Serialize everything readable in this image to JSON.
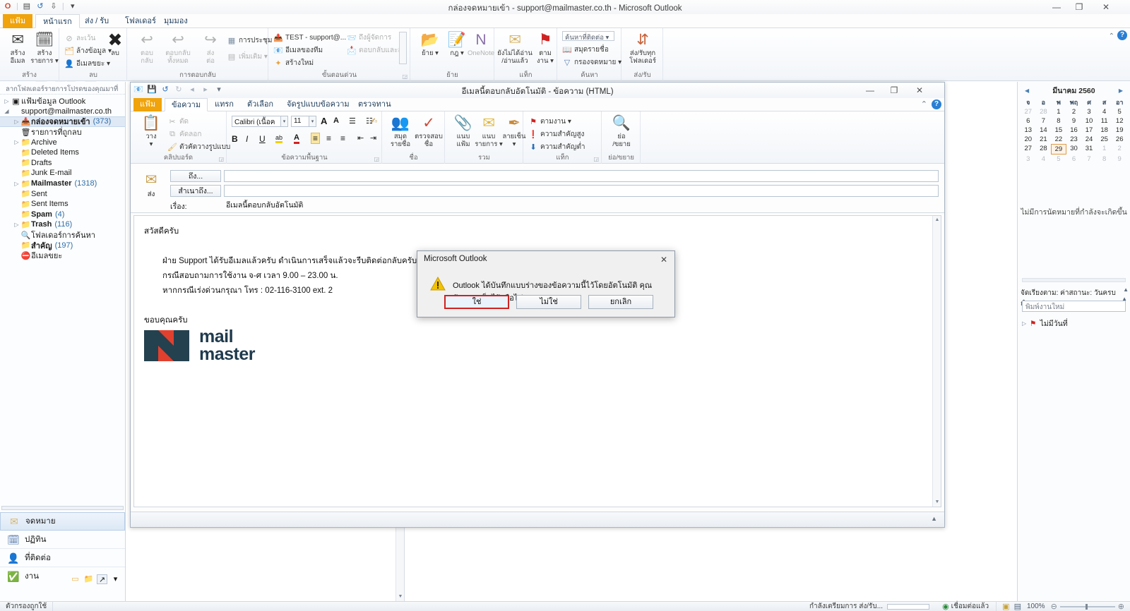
{
  "window": {
    "title": "กล่องจดหมายเข้า - support@mailmaster.co.th  -  Microsoft Outlook",
    "minimize": "—",
    "maximize": "❐",
    "close": "✕",
    "help_icon": "?",
    "ribbon_collapse_icon": "⌃"
  },
  "qat": {
    "app_icon": "O",
    "new_icon": "▤",
    "undo_icon": "↺",
    "sendrecv_icon": "⇩",
    "more_icon": "▾"
  },
  "ribbon_tabs": [
    {
      "label": "แฟ้ม",
      "type": "file"
    },
    {
      "label": "หน้าแรก",
      "type": "active"
    },
    {
      "label": "ส่ง / รับ",
      "type": "normal"
    },
    {
      "label": "โฟลเดอร์",
      "type": "normal"
    },
    {
      "label": "มุมมอง",
      "type": "normal"
    }
  ],
  "ribbon": {
    "groups": [
      {
        "name": "สร้าง",
        "label": "สร้าง"
      },
      {
        "name": "ลบ",
        "label": "ลบ"
      },
      {
        "name": "การตอบกลับ",
        "label": "การตอบกลับ"
      },
      {
        "name": "ขั้นตอนด่วน",
        "label": "ขั้นตอนด่วน"
      },
      {
        "name": "ย้าย",
        "label": "ย้าย"
      },
      {
        "name": "แท็ก",
        "label": "แท็ก"
      },
      {
        "name": "ค้นหา",
        "label": "ค้นหา"
      },
      {
        "name": "ส่ง/รับ",
        "label": "ส่ง/รับ"
      }
    ],
    "new_email": {
      "line1": "สร้าง",
      "line2": "อีเมล",
      "icon": "✉"
    },
    "new_items": {
      "line1": "สร้าง",
      "line2": "รายการ ▾",
      "icon": "🗓"
    },
    "ignore": {
      "label": "ละเว้น",
      "icon": "⊘"
    },
    "cleanup": {
      "label": "ล้างข้อมูล ▾",
      "icon": "🗂"
    },
    "junk": {
      "label": "อีเมลขยะ ▾",
      "icon": "👤"
    },
    "delete": {
      "label": "ลบ",
      "icon": "✖"
    },
    "reply": {
      "line1": "ตอบ",
      "line2": "กลับ",
      "icon": "↩"
    },
    "reply_all": {
      "line1": "ตอบกลับ",
      "line2": "ทั้งหมด",
      "icon": "↩"
    },
    "forward": {
      "line1": "ส่ง",
      "line2": "ต่อ",
      "icon": "↪"
    },
    "meeting": {
      "label": "การประชุม",
      "icon": "▦"
    },
    "more": {
      "label": "เพิ่มเติม ▾",
      "icon": "▤"
    },
    "qs_test": {
      "label": "TEST - support@...",
      "icon": "📤"
    },
    "qs_team": {
      "label": "อีเมลของทีม",
      "icon": "📧"
    },
    "qs_new": {
      "label": "สร้างใหม่",
      "icon": "✦"
    },
    "qs_mgr": {
      "label": "ถึงผู้จัดการ",
      "icon": "📨"
    },
    "qs_replydel": {
      "label": "ตอบกลับและลบ",
      "icon": "📩"
    },
    "move": {
      "label": "ย้าย ▾",
      "icon": "📂"
    },
    "rules": {
      "label": "กฎ ▾",
      "icon": "📝"
    },
    "onenote": {
      "label": "OneNote",
      "icon": "N"
    },
    "unread": {
      "line1": "ยังไม่ได้อ่าน",
      "line2": "/อ่านแล้ว",
      "icon": "✉"
    },
    "followup": {
      "line1": "ตาม",
      "line2": "งาน ▾",
      "icon": "⚑"
    },
    "find_contact": {
      "label": "ค้นหาที่ติดต่อ ▾",
      "icon": ""
    },
    "address_book": {
      "label": "สมุดรายชื่อ",
      "icon": "📖"
    },
    "filter_mail": {
      "label": "กรองจดหมาย ▾",
      "icon": "▽"
    },
    "send_receive_all": {
      "line1": "ส่ง/รับทุก",
      "line2": "โฟลเดอร์",
      "icon": "⇵"
    }
  },
  "navpane": {
    "header": "ลากโฟลเดอร์รายการโปรดของคุณมาที่",
    "header_collapse": "❮",
    "tree": [
      {
        "label": "แฟ้มข้อมูล Outlook",
        "twisty": "▷",
        "icon": "▣",
        "indent": 0,
        "bold": false,
        "count": "",
        "selected": false
      },
      {
        "label": "support@mailmaster.co.th",
        "twisty": "◢",
        "icon": "",
        "indent": 0,
        "bold": false,
        "count": "",
        "selected": false
      },
      {
        "label": "กล่องจดหมายเข้า",
        "twisty": "▷",
        "icon": "📥",
        "indent": 1,
        "bold": true,
        "count": "(373)",
        "selected": true
      },
      {
        "label": "รายการที่ถูกลบ",
        "twisty": "",
        "icon": "🗑",
        "indent": 1,
        "bold": false,
        "count": "",
        "selected": false
      },
      {
        "label": "Archive",
        "twisty": "▷",
        "icon": "📁",
        "indent": 1,
        "bold": false,
        "count": "",
        "selected": false
      },
      {
        "label": "Deleted Items",
        "twisty": "",
        "icon": "📁",
        "indent": 1,
        "bold": false,
        "count": "",
        "selected": false
      },
      {
        "label": "Drafts",
        "twisty": "",
        "icon": "📁",
        "indent": 1,
        "bold": false,
        "count": "",
        "selected": false
      },
      {
        "label": "Junk E-mail",
        "twisty": "",
        "icon": "📁",
        "indent": 1,
        "bold": false,
        "count": "",
        "selected": false
      },
      {
        "label": "Mailmaster",
        "twisty": "▷",
        "icon": "📁",
        "indent": 1,
        "bold": true,
        "count": "(1318)",
        "selected": false
      },
      {
        "label": "Sent",
        "twisty": "",
        "icon": "📁",
        "indent": 1,
        "bold": false,
        "count": "",
        "selected": false
      },
      {
        "label": "Sent Items",
        "twisty": "",
        "icon": "📁",
        "indent": 1,
        "bold": false,
        "count": "",
        "selected": false
      },
      {
        "label": "Spam",
        "twisty": "",
        "icon": "📁",
        "indent": 1,
        "bold": true,
        "count": "(4)",
        "selected": false
      },
      {
        "label": "Trash",
        "twisty": "▷",
        "icon": "📁",
        "indent": 1,
        "bold": true,
        "count": "(116)",
        "selected": false
      },
      {
        "label": "โฟลเดอร์การค้นหา",
        "twisty": "",
        "icon": "🔍",
        "indent": 1,
        "bold": false,
        "count": "",
        "selected": false
      },
      {
        "label": "สำคัญ",
        "twisty": "",
        "icon": "📁",
        "indent": 1,
        "bold": true,
        "count": "(197)",
        "selected": false
      },
      {
        "label": "อีเมลขยะ",
        "twisty": "",
        "icon": "⛔",
        "indent": 1,
        "bold": false,
        "count": "",
        "selected": false
      }
    ],
    "buttons": [
      {
        "label": "จดหมาย",
        "icon": "✉",
        "selected": true
      },
      {
        "label": "ปฏิทิน",
        "icon": "🗓",
        "selected": false
      },
      {
        "label": "ที่ติดต่อ",
        "icon": "👤",
        "selected": false
      },
      {
        "label": "งาน",
        "icon": "✅",
        "selected": false
      }
    ],
    "mini_icons": [
      "▭",
      "📁",
      "↗",
      "▾"
    ]
  },
  "todobar": {
    "calendar": {
      "month_title": "มีนาคม 2560",
      "prev": "◀",
      "next": "▶",
      "dow": [
        "จ",
        "อ",
        "พ",
        "พฤ",
        "ศ",
        "ส",
        "อา"
      ],
      "weeks": [
        [
          {
            "d": "27",
            "o": true
          },
          {
            "d": "28",
            "o": true
          },
          {
            "d": "1"
          },
          {
            "d": "2"
          },
          {
            "d": "3"
          },
          {
            "d": "4"
          },
          {
            "d": "5"
          }
        ],
        [
          {
            "d": "6"
          },
          {
            "d": "7"
          },
          {
            "d": "8"
          },
          {
            "d": "9"
          },
          {
            "d": "10"
          },
          {
            "d": "11"
          },
          {
            "d": "12"
          }
        ],
        [
          {
            "d": "13"
          },
          {
            "d": "14"
          },
          {
            "d": "15"
          },
          {
            "d": "16"
          },
          {
            "d": "17"
          },
          {
            "d": "18"
          },
          {
            "d": "19"
          }
        ],
        [
          {
            "d": "20"
          },
          {
            "d": "21"
          },
          {
            "d": "22"
          },
          {
            "d": "23"
          },
          {
            "d": "24"
          },
          {
            "d": "25"
          },
          {
            "d": "26"
          }
        ],
        [
          {
            "d": "27"
          },
          {
            "d": "28"
          },
          {
            "d": "29",
            "t": true
          },
          {
            "d": "30"
          },
          {
            "d": "31"
          },
          {
            "d": "1",
            "o": true
          },
          {
            "d": "2",
            "o": true
          }
        ],
        [
          {
            "d": "3",
            "o": true
          },
          {
            "d": "4",
            "o": true
          },
          {
            "d": "5",
            "o": true
          },
          {
            "d": "6",
            "o": true
          },
          {
            "d": "7",
            "o": true
          },
          {
            "d": "8",
            "o": true
          },
          {
            "d": "9",
            "o": true
          }
        ]
      ]
    },
    "no_appointments": "ไม่มีการนัดหมายที่กำลังจะเกิดขึ้น",
    "sort_label": "จัดเรียงตาม: ค่าสถานะ: วันครบกำหนด",
    "sort_up1": "▲",
    "sort_up2": "▲",
    "new_task_placeholder": "พิมพ์งานใหม่",
    "group_row": {
      "twisty": "▷",
      "flag": "⚑",
      "label": "ไม่มีวันที่"
    }
  },
  "statusbar": {
    "filter_label": "ตัวกรองถูกใช้",
    "progress_text": "กำลังเตรียมการ ส่ง/รับ...",
    "connected": "เชื่อมต่อแล้ว",
    "connected_icon": "◉",
    "view_normal_icon": "▣",
    "view_reading_icon": "▤",
    "zoom_level": "100%",
    "zoom_out": "⊖",
    "zoom_in": "⊕"
  },
  "compose": {
    "title": "อีเมลนี้ตอบกลับอัตโนมัติ - ข้อความ (HTML)",
    "minimize": "—",
    "maximize": "❐",
    "close": "✕",
    "qat": [
      "📧",
      "💾",
      "↺",
      "↻",
      "◂",
      "▸",
      "▾"
    ],
    "help_icon": "?",
    "collapse_icon": "⌃",
    "tabs": [
      {
        "label": "แฟ้ม",
        "type": "file"
      },
      {
        "label": "ข้อความ",
        "type": "active"
      },
      {
        "label": "แทรก",
        "type": "normal"
      },
      {
        "label": "ตัวเลือก",
        "type": "normal"
      },
      {
        "label": "จัดรูปแบบข้อความ",
        "type": "normal"
      },
      {
        "label": "ตรวจทาน",
        "type": "normal"
      }
    ],
    "groups": [
      {
        "label": "คลิปบอร์ด"
      },
      {
        "label": "ข้อความพื้นฐาน"
      },
      {
        "label": "ชื่อ"
      },
      {
        "label": "รวม"
      },
      {
        "label": "แท็ก"
      },
      {
        "label": "ย่อ/ขยาย"
      }
    ],
    "paste": {
      "label": "วาง",
      "sub": "▾",
      "icon": "📋"
    },
    "cut": {
      "label": "ตัด",
      "icon": "✂"
    },
    "copy": {
      "label": "คัดลอก",
      "icon": "⧉"
    },
    "format_painter": {
      "label": "ตัวคัดวางรูปแบบ",
      "icon": "🖌"
    },
    "font_name": "Calibri (เนื้อค",
    "font_size": "11",
    "grow_font": "A",
    "shrink_font": "A",
    "bullets": "☰",
    "numbering": "☷",
    "clearfmt": "✍",
    "bold": "B",
    "italic": "I",
    "underline": "U",
    "highlight": "ab",
    "fontcolor": "A",
    "align_left": "≡",
    "align_center": "≡",
    "align_right": "≡",
    "indent_dec": "⇤",
    "indent_inc": "⇥",
    "address_book": {
      "line1": "สมุด",
      "line2": "รายชื่อ",
      "icon": "👥"
    },
    "check_names": {
      "line1": "ตรวจสอบ",
      "line2": "ชื่อ",
      "icon": "✓"
    },
    "attach_file": {
      "line1": "แนบ",
      "line2": "แฟ้ม",
      "icon": "📎"
    },
    "attach_item": {
      "line1": "แนบ",
      "line2": "รายการ ▾",
      "icon": "✉"
    },
    "signature": {
      "line1": "ลายเซ็น",
      "line2": "▾",
      "icon": "✒"
    },
    "follow_up": {
      "label": "ตามงาน ▾",
      "icon": "⚑"
    },
    "high_importance": {
      "label": "ความสำคัญสูง",
      "icon": "❗"
    },
    "low_importance": {
      "label": "ความสำคัญต่ำ",
      "icon": "⬇"
    },
    "zoom": {
      "line1": "ย่อ",
      "line2": "/ขยาย",
      "icon": "🔍"
    },
    "send_button": {
      "label": "ส่ง",
      "icon": "✉"
    },
    "to_button": "ถึง...",
    "cc_button": "สำเนาถึง...",
    "subject_label": "เรื่อง:",
    "to_value": "",
    "cc_value": "",
    "subject_value": "อีเมลนี้ตอบกลับอัตโนมัติ",
    "body_lines": [
      "สวัสดีครับ",
      "",
      "ฝ่าย Support ได้รับอีเมลแล้วครับ ดำเนินการเสร็จแล้วจะรีบติดต่อกลับครับ",
      "กรณีสอบถามการใช้งาน จ-ศ เวลา 9.00 – 23.00 น.",
      "หากกรณีเร่งด่วนกรุณา โทร : 02-116-3100 ext. 2",
      "",
      "ขอบคุณครับ"
    ],
    "logo": {
      "word1": "mail",
      "word2": "master",
      "dark_color": "#24414f",
      "red_color": "#e2402f"
    }
  },
  "dialog": {
    "title": "Microsoft Outlook",
    "close": "✕",
    "warning_icon": "!",
    "message": "Outlook ได้บันทึกแบบร่างของข้อความนี้ไว้โดยอัตโนมัติ คุณต้องการเก็บไว้หรือไม่",
    "buttons": [
      {
        "label": "ใช่",
        "primary": true
      },
      {
        "label": "ไม่ใช่",
        "primary": false
      },
      {
        "label": "ยกเลิก",
        "primary": false
      }
    ]
  },
  "watermarks": {
    "w1": "mail",
    "w2": "master"
  }
}
